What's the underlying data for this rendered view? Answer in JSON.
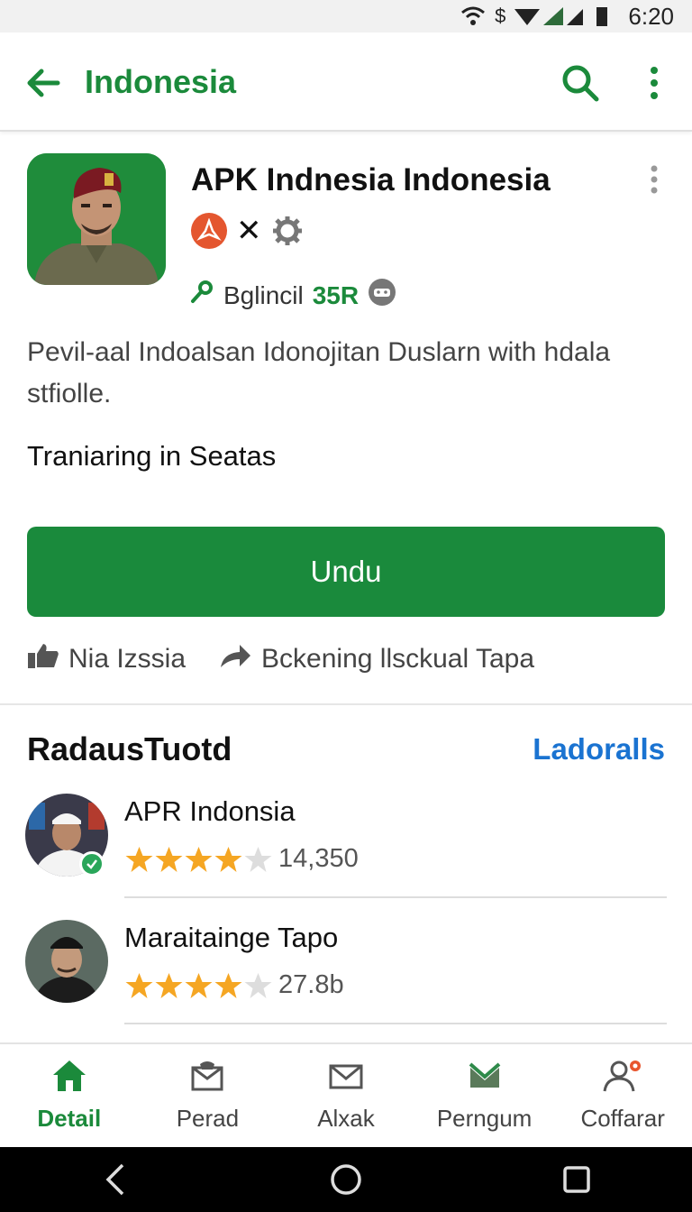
{
  "status_bar": {
    "time": "6:20"
  },
  "app_bar": {
    "title": "Indonesia"
  },
  "app": {
    "name": "APK Indnesia Indonesia",
    "developer": "Bglincil",
    "developer_count": "35R",
    "description": "Pevil-aal Indoalsan Idonojitan Duslarn with hdala stfiolle.",
    "subtitle": "Traniaring in Seatas",
    "download_label": "Undu",
    "action_like": "Nia Izssia",
    "action_share": "Bckening llsckual Tapa"
  },
  "related": {
    "title": "RadausTuotd",
    "link": "Ladoralls",
    "items": [
      {
        "name": "APR Indonsia",
        "stars": 4,
        "count": "14,350"
      },
      {
        "name": "Maraitainge Tapo",
        "stars": 4,
        "count": "27.8b"
      }
    ]
  },
  "bottom_nav": [
    {
      "label": "Detail",
      "icon": "home-icon",
      "active": true
    },
    {
      "label": "Perad",
      "icon": "inbox-icon",
      "active": false
    },
    {
      "label": "Alxak",
      "icon": "mail-icon",
      "active": false
    },
    {
      "label": "Perngum",
      "icon": "layers-icon",
      "active": false
    },
    {
      "label": "Coffarar",
      "icon": "person-icon",
      "active": false
    }
  ],
  "colors": {
    "accent": "#1b8a3b",
    "link": "#1a73d1",
    "star": "#f5a623"
  }
}
